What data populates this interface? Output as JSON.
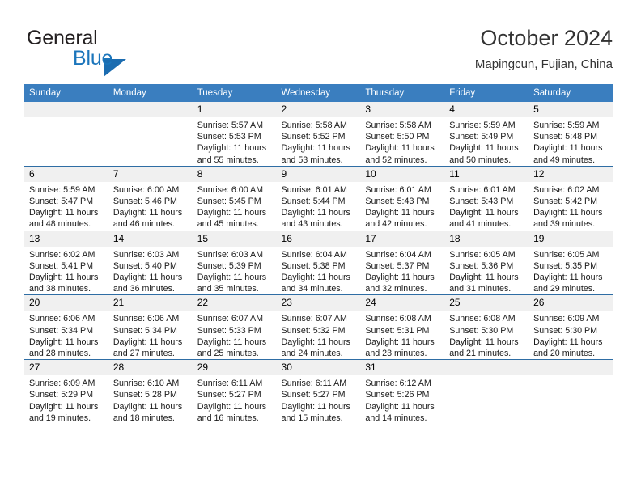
{
  "brand": {
    "word_one": "General",
    "word_two": "Blue",
    "triangle_color": "#1b6cb0",
    "blue_color": "#1b75bb"
  },
  "header": {
    "title": "October 2024",
    "location": "Mapingcun, Fujian, China"
  },
  "theme": {
    "header_bg": "#3a7ebf",
    "row_border": "#2e6da4",
    "daynum_bg": "#f0f0f0"
  },
  "weekdays": [
    "Sunday",
    "Monday",
    "Tuesday",
    "Wednesday",
    "Thursday",
    "Friday",
    "Saturday"
  ],
  "weeks": [
    [
      {
        "day": "",
        "empty": true,
        "sunrise": "",
        "sunset": "",
        "daylight_1": "",
        "daylight_2": ""
      },
      {
        "day": "",
        "empty": true,
        "sunrise": "",
        "sunset": "",
        "daylight_1": "",
        "daylight_2": ""
      },
      {
        "day": "1",
        "sunrise": "Sunrise: 5:57 AM",
        "sunset": "Sunset: 5:53 PM",
        "daylight_1": "Daylight: 11 hours",
        "daylight_2": "and 55 minutes."
      },
      {
        "day": "2",
        "sunrise": "Sunrise: 5:58 AM",
        "sunset": "Sunset: 5:52 PM",
        "daylight_1": "Daylight: 11 hours",
        "daylight_2": "and 53 minutes."
      },
      {
        "day": "3",
        "sunrise": "Sunrise: 5:58 AM",
        "sunset": "Sunset: 5:50 PM",
        "daylight_1": "Daylight: 11 hours",
        "daylight_2": "and 52 minutes."
      },
      {
        "day": "4",
        "sunrise": "Sunrise: 5:59 AM",
        "sunset": "Sunset: 5:49 PM",
        "daylight_1": "Daylight: 11 hours",
        "daylight_2": "and 50 minutes."
      },
      {
        "day": "5",
        "sunrise": "Sunrise: 5:59 AM",
        "sunset": "Sunset: 5:48 PM",
        "daylight_1": "Daylight: 11 hours",
        "daylight_2": "and 49 minutes."
      }
    ],
    [
      {
        "day": "6",
        "sunrise": "Sunrise: 5:59 AM",
        "sunset": "Sunset: 5:47 PM",
        "daylight_1": "Daylight: 11 hours",
        "daylight_2": "and 48 minutes."
      },
      {
        "day": "7",
        "sunrise": "Sunrise: 6:00 AM",
        "sunset": "Sunset: 5:46 PM",
        "daylight_1": "Daylight: 11 hours",
        "daylight_2": "and 46 minutes."
      },
      {
        "day": "8",
        "sunrise": "Sunrise: 6:00 AM",
        "sunset": "Sunset: 5:45 PM",
        "daylight_1": "Daylight: 11 hours",
        "daylight_2": "and 45 minutes."
      },
      {
        "day": "9",
        "sunrise": "Sunrise: 6:01 AM",
        "sunset": "Sunset: 5:44 PM",
        "daylight_1": "Daylight: 11 hours",
        "daylight_2": "and 43 minutes."
      },
      {
        "day": "10",
        "sunrise": "Sunrise: 6:01 AM",
        "sunset": "Sunset: 5:43 PM",
        "daylight_1": "Daylight: 11 hours",
        "daylight_2": "and 42 minutes."
      },
      {
        "day": "11",
        "sunrise": "Sunrise: 6:01 AM",
        "sunset": "Sunset: 5:43 PM",
        "daylight_1": "Daylight: 11 hours",
        "daylight_2": "and 41 minutes."
      },
      {
        "day": "12",
        "sunrise": "Sunrise: 6:02 AM",
        "sunset": "Sunset: 5:42 PM",
        "daylight_1": "Daylight: 11 hours",
        "daylight_2": "and 39 minutes."
      }
    ],
    [
      {
        "day": "13",
        "sunrise": "Sunrise: 6:02 AM",
        "sunset": "Sunset: 5:41 PM",
        "daylight_1": "Daylight: 11 hours",
        "daylight_2": "and 38 minutes."
      },
      {
        "day": "14",
        "sunrise": "Sunrise: 6:03 AM",
        "sunset": "Sunset: 5:40 PM",
        "daylight_1": "Daylight: 11 hours",
        "daylight_2": "and 36 minutes."
      },
      {
        "day": "15",
        "sunrise": "Sunrise: 6:03 AM",
        "sunset": "Sunset: 5:39 PM",
        "daylight_1": "Daylight: 11 hours",
        "daylight_2": "and 35 minutes."
      },
      {
        "day": "16",
        "sunrise": "Sunrise: 6:04 AM",
        "sunset": "Sunset: 5:38 PM",
        "daylight_1": "Daylight: 11 hours",
        "daylight_2": "and 34 minutes."
      },
      {
        "day": "17",
        "sunrise": "Sunrise: 6:04 AM",
        "sunset": "Sunset: 5:37 PM",
        "daylight_1": "Daylight: 11 hours",
        "daylight_2": "and 32 minutes."
      },
      {
        "day": "18",
        "sunrise": "Sunrise: 6:05 AM",
        "sunset": "Sunset: 5:36 PM",
        "daylight_1": "Daylight: 11 hours",
        "daylight_2": "and 31 minutes."
      },
      {
        "day": "19",
        "sunrise": "Sunrise: 6:05 AM",
        "sunset": "Sunset: 5:35 PM",
        "daylight_1": "Daylight: 11 hours",
        "daylight_2": "and 29 minutes."
      }
    ],
    [
      {
        "day": "20",
        "sunrise": "Sunrise: 6:06 AM",
        "sunset": "Sunset: 5:34 PM",
        "daylight_1": "Daylight: 11 hours",
        "daylight_2": "and 28 minutes."
      },
      {
        "day": "21",
        "sunrise": "Sunrise: 6:06 AM",
        "sunset": "Sunset: 5:34 PM",
        "daylight_1": "Daylight: 11 hours",
        "daylight_2": "and 27 minutes."
      },
      {
        "day": "22",
        "sunrise": "Sunrise: 6:07 AM",
        "sunset": "Sunset: 5:33 PM",
        "daylight_1": "Daylight: 11 hours",
        "daylight_2": "and 25 minutes."
      },
      {
        "day": "23",
        "sunrise": "Sunrise: 6:07 AM",
        "sunset": "Sunset: 5:32 PM",
        "daylight_1": "Daylight: 11 hours",
        "daylight_2": "and 24 minutes."
      },
      {
        "day": "24",
        "sunrise": "Sunrise: 6:08 AM",
        "sunset": "Sunset: 5:31 PM",
        "daylight_1": "Daylight: 11 hours",
        "daylight_2": "and 23 minutes."
      },
      {
        "day": "25",
        "sunrise": "Sunrise: 6:08 AM",
        "sunset": "Sunset: 5:30 PM",
        "daylight_1": "Daylight: 11 hours",
        "daylight_2": "and 21 minutes."
      },
      {
        "day": "26",
        "sunrise": "Sunrise: 6:09 AM",
        "sunset": "Sunset: 5:30 PM",
        "daylight_1": "Daylight: 11 hours",
        "daylight_2": "and 20 minutes."
      }
    ],
    [
      {
        "day": "27",
        "sunrise": "Sunrise: 6:09 AM",
        "sunset": "Sunset: 5:29 PM",
        "daylight_1": "Daylight: 11 hours",
        "daylight_2": "and 19 minutes."
      },
      {
        "day": "28",
        "sunrise": "Sunrise: 6:10 AM",
        "sunset": "Sunset: 5:28 PM",
        "daylight_1": "Daylight: 11 hours",
        "daylight_2": "and 18 minutes."
      },
      {
        "day": "29",
        "sunrise": "Sunrise: 6:11 AM",
        "sunset": "Sunset: 5:27 PM",
        "daylight_1": "Daylight: 11 hours",
        "daylight_2": "and 16 minutes."
      },
      {
        "day": "30",
        "sunrise": "Sunrise: 6:11 AM",
        "sunset": "Sunset: 5:27 PM",
        "daylight_1": "Daylight: 11 hours",
        "daylight_2": "and 15 minutes."
      },
      {
        "day": "31",
        "sunrise": "Sunrise: 6:12 AM",
        "sunset": "Sunset: 5:26 PM",
        "daylight_1": "Daylight: 11 hours",
        "daylight_2": "and 14 minutes."
      },
      {
        "day": "",
        "empty": true,
        "sunrise": "",
        "sunset": "",
        "daylight_1": "",
        "daylight_2": ""
      },
      {
        "day": "",
        "empty": true,
        "sunrise": "",
        "sunset": "",
        "daylight_1": "",
        "daylight_2": ""
      }
    ]
  ]
}
